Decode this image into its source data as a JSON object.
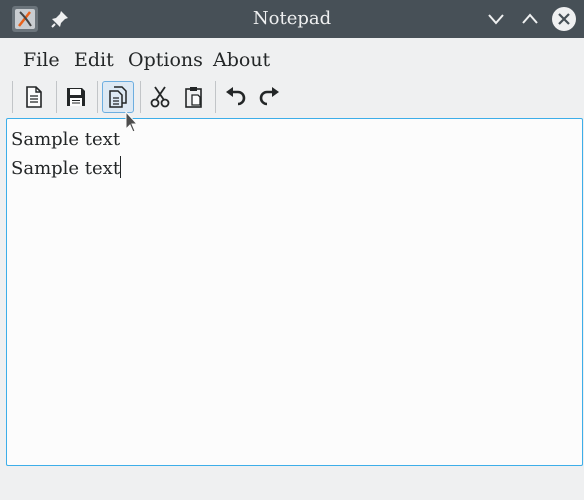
{
  "window": {
    "title": "Notepad"
  },
  "menu": {
    "items": [
      "File",
      "Edit",
      "Options",
      "About"
    ]
  },
  "toolbar": {
    "buttons": [
      "new-document-icon",
      "save-icon",
      "copy-icon",
      "cut-icon",
      "paste-icon",
      "undo-icon",
      "redo-icon"
    ]
  },
  "editor": {
    "lines": [
      "Sample text",
      "Sample text"
    ]
  },
  "colors": {
    "titlebar": "#475057",
    "accent": "#3daee9",
    "background": "#eff0f1"
  }
}
